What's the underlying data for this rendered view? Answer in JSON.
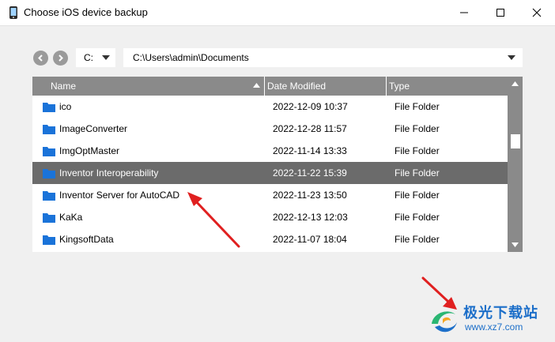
{
  "window": {
    "title": "Choose iOS device backup",
    "controls": [
      "minimize-icon",
      "maximize-icon",
      "close-icon"
    ]
  },
  "toolbar": {
    "back_icon": "chevron-left-icon",
    "forward_icon": "chevron-right-icon",
    "drive": "C:",
    "path": "C:\\Users\\admin\\Documents"
  },
  "table": {
    "columns": [
      "Name",
      "Date Modified",
      "Type"
    ],
    "sort_column": "Name",
    "rows": [
      {
        "name": "ico",
        "date": "2022-12-09 10:37",
        "type": "File Folder"
      },
      {
        "name": "ImageConverter",
        "date": "2022-12-28 11:57",
        "type": "File Folder"
      },
      {
        "name": "ImgOptMaster",
        "date": "2022-11-14 13:33",
        "type": "File Folder"
      },
      {
        "name": "Inventor Interoperability",
        "date": "2022-11-22 15:39",
        "type": "File Folder",
        "selected": true
      },
      {
        "name": "Inventor Server for AutoCAD",
        "date": "2022-11-23 13:50",
        "type": "File Folder"
      },
      {
        "name": "KaKa",
        "date": "2022-12-13 12:03",
        "type": "File Folder"
      },
      {
        "name": "KingsoftData",
        "date": "2022-11-07 18:04",
        "type": "File Folder"
      }
    ]
  },
  "colors": {
    "header_bg": "#8a8a8a",
    "selected_row_bg": "#6b6b6b",
    "folder_icon": "#1a73d9",
    "annotation_arrow": "#e02020",
    "watermark": "#1d6fc9"
  },
  "watermark": {
    "brand": "极光下载站",
    "url": "www.xz7.com"
  }
}
